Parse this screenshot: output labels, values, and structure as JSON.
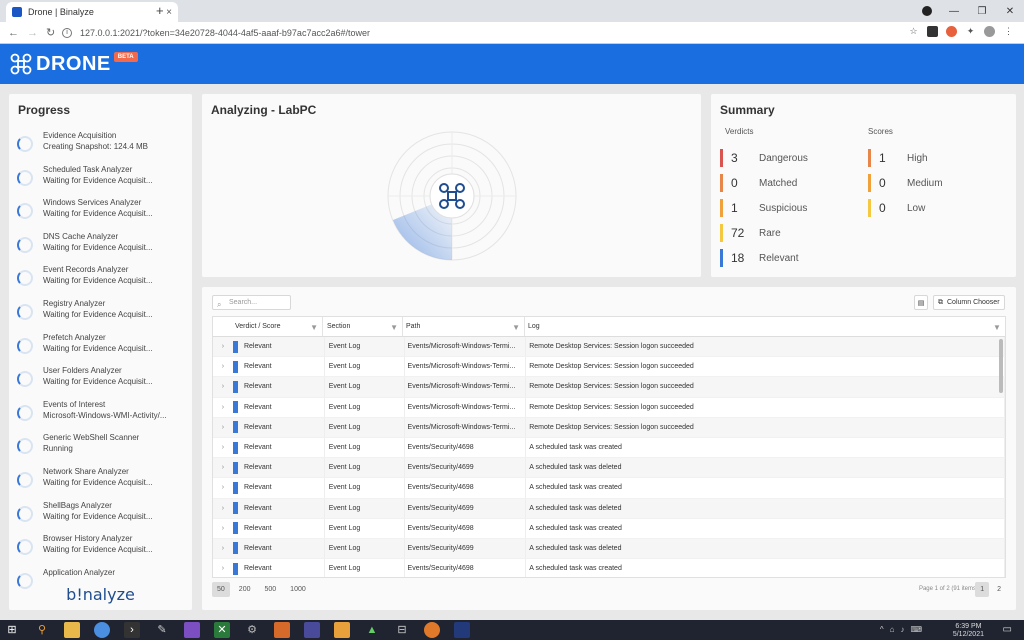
{
  "browser": {
    "tab_title": "Drone | Binalyze",
    "tab_close": "×",
    "new_tab": "+",
    "url": "127.0.0.1:2021/?token=34e20728-4044-4af5-aaaf-b97ac7acc2a6#/tower"
  },
  "app": {
    "brand": "DRONE",
    "beta": "BETA"
  },
  "progress": {
    "title": "Progress",
    "footer_logo": "b!nalyze",
    "items": [
      {
        "title": "Evidence Acquisition",
        "status": "Creating Snapshot: 124.4 MB"
      },
      {
        "title": "Scheduled Task Analyzer",
        "status": "Waiting for Evidence Acquisit..."
      },
      {
        "title": "Windows Services Analyzer",
        "status": "Waiting for Evidence Acquisit..."
      },
      {
        "title": "DNS Cache Analyzer",
        "status": "Waiting for Evidence Acquisit..."
      },
      {
        "title": "Event Records Analyzer",
        "status": "Waiting for Evidence Acquisit..."
      },
      {
        "title": "Registry Analyzer",
        "status": "Waiting for Evidence Acquisit..."
      },
      {
        "title": "Prefetch Analyzer",
        "status": "Waiting for Evidence Acquisit..."
      },
      {
        "title": "User Folders Analyzer",
        "status": "Waiting for Evidence Acquisit..."
      },
      {
        "title": "Events of Interest",
        "status": "Microsoft-Windows-WMI-Activity/..."
      },
      {
        "title": "Generic WebShell Scanner",
        "status": "Running"
      },
      {
        "title": "Network Share Analyzer",
        "status": "Waiting for Evidence Acquisit..."
      },
      {
        "title": "ShellBags Analyzer",
        "status": "Waiting for Evidence Acquisit..."
      },
      {
        "title": "Browser History Analyzer",
        "status": "Waiting for Evidence Acquisit..."
      },
      {
        "title": "Application Analyzer",
        "status": ""
      }
    ]
  },
  "analyzing": {
    "title": "Analyzing - LabPC"
  },
  "summary": {
    "title": "Summary",
    "verdicts_label": "Verdicts",
    "scores_label": "Scores",
    "verdicts": [
      {
        "count": "3",
        "label": "Dangerous",
        "color": "#d9534f"
      },
      {
        "count": "0",
        "label": "Matched",
        "color": "#e8864a"
      },
      {
        "count": "1",
        "label": "Suspicious",
        "color": "#f0a13a"
      },
      {
        "count": "72",
        "label": "Rare",
        "color": "#f5c842"
      },
      {
        "count": "18",
        "label": "Relevant",
        "color": "#3a78d8"
      }
    ],
    "scores": [
      {
        "count": "1",
        "label": "High",
        "color": "#e8864a"
      },
      {
        "count": "0",
        "label": "Medium",
        "color": "#f0a13a"
      },
      {
        "count": "0",
        "label": "Low",
        "color": "#f5c842"
      }
    ]
  },
  "table": {
    "search_placeholder": "Search...",
    "column_chooser": "Column Chooser",
    "columns": [
      "Verdict / Score",
      "Section",
      "Path",
      "Log"
    ],
    "rows": [
      {
        "verdict": "Relevant",
        "section": "Event Log",
        "path": "Events/Microsoft-Windows-Termi...",
        "log": "Remote Desktop Services: Session logon succeeded"
      },
      {
        "verdict": "Relevant",
        "section": "Event Log",
        "path": "Events/Microsoft-Windows-Termi...",
        "log": "Remote Desktop Services: Session logon succeeded"
      },
      {
        "verdict": "Relevant",
        "section": "Event Log",
        "path": "Events/Microsoft-Windows-Termi...",
        "log": "Remote Desktop Services: Session logon succeeded"
      },
      {
        "verdict": "Relevant",
        "section": "Event Log",
        "path": "Events/Microsoft-Windows-Termi...",
        "log": "Remote Desktop Services: Session logon succeeded"
      },
      {
        "verdict": "Relevant",
        "section": "Event Log",
        "path": "Events/Microsoft-Windows-Termi...",
        "log": "Remote Desktop Services: Session logon succeeded"
      },
      {
        "verdict": "Relevant",
        "section": "Event Log",
        "path": "Events/Security/4698",
        "log": "A scheduled task was created"
      },
      {
        "verdict": "Relevant",
        "section": "Event Log",
        "path": "Events/Security/4699",
        "log": "A scheduled task was deleted"
      },
      {
        "verdict": "Relevant",
        "section": "Event Log",
        "path": "Events/Security/4698",
        "log": "A scheduled task was created"
      },
      {
        "verdict": "Relevant",
        "section": "Event Log",
        "path": "Events/Security/4699",
        "log": "A scheduled task was deleted"
      },
      {
        "verdict": "Relevant",
        "section": "Event Log",
        "path": "Events/Security/4698",
        "log": "A scheduled task was created"
      },
      {
        "verdict": "Relevant",
        "section": "Event Log",
        "path": "Events/Security/4699",
        "log": "A scheduled task was deleted"
      },
      {
        "verdict": "Relevant",
        "section": "Event Log",
        "path": "Events/Security/4698",
        "log": "A scheduled task was created"
      }
    ],
    "page_sizes": [
      "50",
      "200",
      "500",
      "1000"
    ],
    "page_info": "Page 1 of 2 (91 items)",
    "pages": [
      "1",
      "2"
    ]
  },
  "taskbar": {
    "time": "6:39 PM",
    "date": "5/12/2021"
  }
}
